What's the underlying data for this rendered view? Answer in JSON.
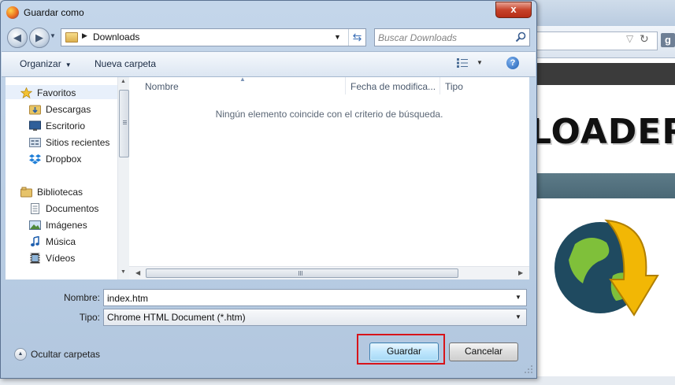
{
  "dialog": {
    "title": "Guardar como",
    "close_label": "x"
  },
  "address": {
    "breadcrumb": "Downloads",
    "search_placeholder": "Buscar Downloads"
  },
  "toolbar": {
    "organize_label": "Organizar",
    "new_folder_label": "Nueva carpeta",
    "help_label": "?"
  },
  "nav": {
    "items": [
      {
        "label": "Favoritos",
        "icon": "star-icon",
        "group": true
      },
      {
        "label": "Descargas",
        "icon": "downloads-folder-icon",
        "group": false
      },
      {
        "label": "Escritorio",
        "icon": "desktop-icon",
        "group": false
      },
      {
        "label": "Sitios recientes",
        "icon": "recent-places-icon",
        "group": false
      },
      {
        "label": "Dropbox",
        "icon": "dropbox-icon",
        "group": false
      },
      {
        "label": "Bibliotecas",
        "icon": "libraries-icon",
        "group": true
      },
      {
        "label": "Documentos",
        "icon": "documents-icon",
        "group": false
      },
      {
        "label": "Imágenes",
        "icon": "pictures-icon",
        "group": false
      },
      {
        "label": "Música",
        "icon": "music-icon",
        "group": false
      },
      {
        "label": "Vídeos",
        "icon": "videos-icon",
        "group": false
      }
    ]
  },
  "file_list": {
    "columns": [
      "Nombre",
      "Fecha de modifica...",
      "Tipo"
    ],
    "empty_message": "Ningún elemento coincide con el criterio de búsqueda."
  },
  "form": {
    "name_label": "Nombre:",
    "name_value": "index.htm",
    "type_label": "Tipo:",
    "type_value": "Chrome HTML Document (*.htm)"
  },
  "footer": {
    "hide_folders_label": "Ocultar carpetas",
    "save_label": "Guardar",
    "cancel_label": "Cancelar"
  },
  "background": {
    "logo_text": "LOADER",
    "search_engine_badge": "g"
  },
  "colors": {
    "highlight": "#d7141a",
    "accent": "#3c7fb1"
  }
}
